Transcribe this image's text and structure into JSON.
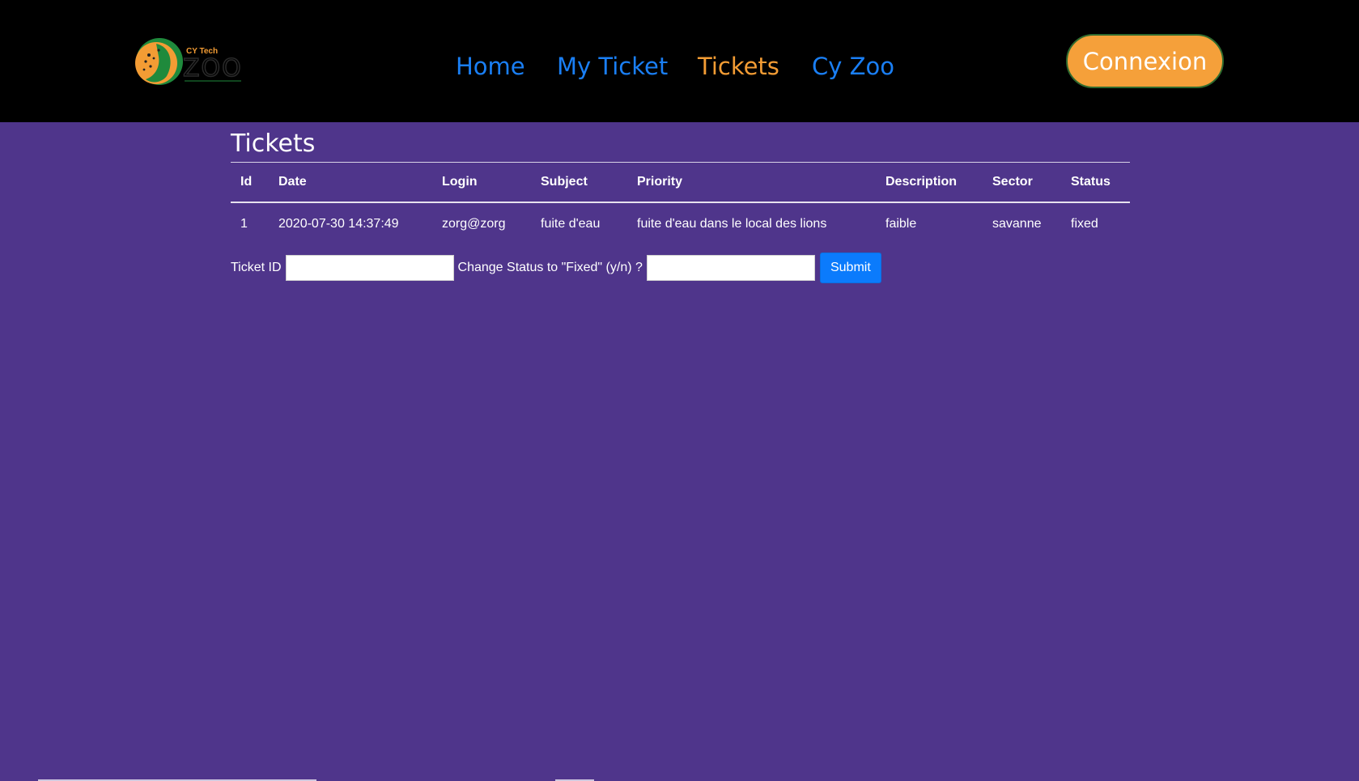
{
  "header": {
    "logo": {
      "small_text": "CY Tech",
      "large_text": "ZOO",
      "colors": {
        "orange": "#f39c34",
        "green": "#1f8a3c"
      }
    },
    "nav": [
      {
        "label": "Home",
        "color": "#1a7ff5",
        "active": false
      },
      {
        "label": "My Ticket",
        "color": "#1a7ff5",
        "active": false
      },
      {
        "label": "Tickets",
        "color": "#f39c34",
        "active": true
      },
      {
        "label": "Cy Zoo",
        "color": "#1a7ff5",
        "active": false
      }
    ],
    "connexion": {
      "label": "Connexion",
      "color": "#f5a03a"
    }
  },
  "main": {
    "title": "Tickets",
    "table": {
      "columns": [
        "Id",
        "Date",
        "Login",
        "Subject",
        "Priority",
        "Description",
        "Sector",
        "Status"
      ],
      "rows": [
        [
          "1",
          "2020-07-30 14:37:49",
          "zorg@zorg",
          "fuite d'eau",
          "fuite d'eau dans le local des lions",
          "faible",
          "savanne",
          "fixed"
        ]
      ]
    },
    "form": {
      "ticket_id_label": "Ticket ID",
      "ticket_id_value": "",
      "status_label": "Change Status to \"Fixed\" (y/n) ?",
      "status_value": "",
      "submit_label": "Submit"
    }
  },
  "colors": {
    "background": "#4f358b",
    "header_bg": "#000000",
    "submit": "#0b7bfc"
  }
}
